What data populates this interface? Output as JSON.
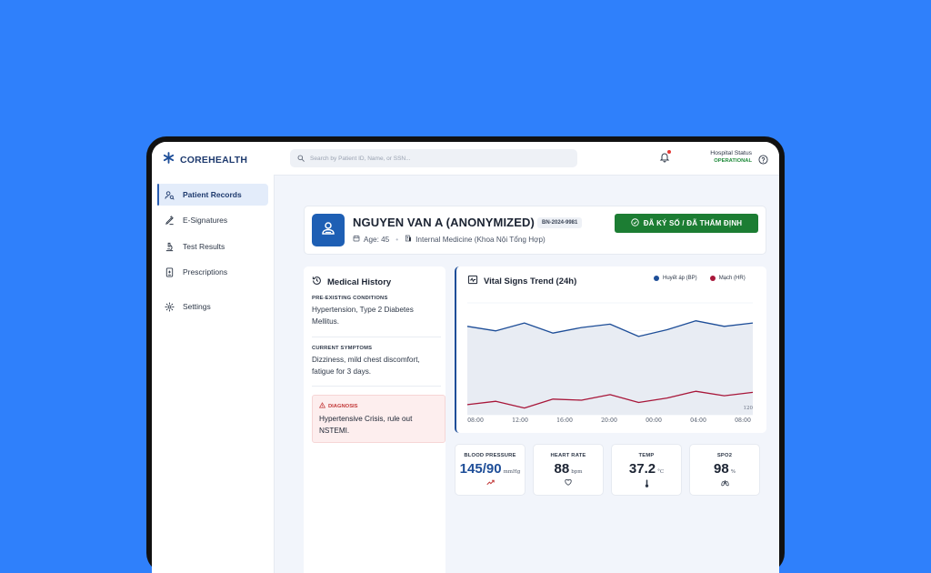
{
  "app": {
    "brand": "COREHEALTH"
  },
  "search": {
    "placeholder": "Search by Patient ID, Name, or SSN..."
  },
  "header": {
    "status_label": "Hospital Status",
    "status_value": "OPERATIONAL"
  },
  "sidebar": {
    "items": [
      {
        "label": "Patient Records",
        "icon": "user-search-icon",
        "active": true
      },
      {
        "label": "E-Signatures",
        "icon": "pen-signature-icon"
      },
      {
        "label": "Test Results",
        "icon": "microscope-icon"
      },
      {
        "label": "Prescriptions",
        "icon": "prescription-icon"
      },
      {
        "label": "Settings",
        "icon": "gear-icon"
      }
    ]
  },
  "patient": {
    "name": "NGUYEN VAN A (ANONYMIZED)",
    "id": "BN-2024-9981",
    "age": "Age: 45",
    "department": "Internal Medicine (Khoa Nội Tổng Hợp)",
    "sign_label": "ĐÃ KÝ SỐ / ĐÃ THẨM ĐỊNH"
  },
  "history": {
    "title": "Medical History",
    "preexisting_label": "PRE-EXISTING CONDITIONS",
    "preexisting_text": "Hypertension, Type 2 Diabetes Mellitus.",
    "symptoms_label": "CURRENT SYMPTOMS",
    "symptoms_text": "Dizziness, mild chest discomfort, fatigue for 3 days.",
    "diagnosis_label": "DIAGNOSIS",
    "diagnosis_text": "Hypertensive Crisis, rule out NSTEMI."
  },
  "chart": {
    "title": "Vital Signs Trend (24h)",
    "y_marker": "120",
    "colors": {
      "bp": "#1e4e98",
      "hr": "#a8173a"
    }
  },
  "chart_data": {
    "type": "line",
    "x": [
      "08:00",
      "10:00",
      "12:00",
      "14:00",
      "16:00",
      "18:00",
      "20:00",
      "22:00",
      "00:00",
      "02:00",
      "04:00",
      "06:00",
      "08:00"
    ],
    "x_tick_labels": [
      "08:00",
      "12:00",
      "16:00",
      "20:00",
      "00:00",
      "04:00",
      "08:00"
    ],
    "series": [
      {
        "name": "Huyết áp (BP)",
        "values": [
          154,
          150,
          157,
          148,
          153,
          156,
          145,
          151,
          159,
          154,
          157
        ]
      },
      {
        "name": "Mạch (HR)",
        "values": [
          84,
          87,
          81,
          89,
          88,
          93,
          86,
          90,
          96,
          92,
          95
        ]
      }
    ],
    "ylim": [
      75,
      175
    ],
    "grid": true,
    "legend": "top-right"
  },
  "vitals": [
    {
      "label": "BLOOD PRESSURE",
      "value": "145/90",
      "unit": "mmHg",
      "icon": "trend-up-icon"
    },
    {
      "label": "HEART RATE",
      "value": "88",
      "unit": "bpm",
      "icon": "heart-icon"
    },
    {
      "label": "TEMP",
      "value": "37.2",
      "unit": "°C",
      "icon": "thermometer-icon"
    },
    {
      "label": "SPO2",
      "value": "98",
      "unit": "%",
      "icon": "lungs-icon"
    }
  ]
}
